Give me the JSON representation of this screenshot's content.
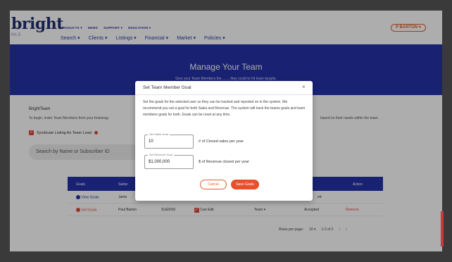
{
  "header": {
    "logo": "bright",
    "logo_sub": "MLS",
    "util_nav": [
      "PRODUCTS ▾",
      "NEWS",
      "SUPPORT ▾",
      "EDUCATION ▾"
    ],
    "main_nav": [
      "Search ▾",
      "Clients ▾",
      "Listings ▾",
      "Financial ▾",
      "Market ▾",
      "Policies ▾"
    ],
    "user": "P BARTON ▾"
  },
  "banner": {
    "title": "Manage Your Team",
    "subtitle": "Give your Team Members the ...                 ... they could to hit team targets."
  },
  "content": {
    "team_label": "BrightTeam",
    "team_desc": "To begin, invite Team Members from your brokerag",
    "team_desc_right": "based on their needs within the team.",
    "syndicate_label": "Syndicate Listing As Team Lead",
    "search_placeholder": "Search by Name or Subscriber ID"
  },
  "table": {
    "headers": [
      "Goals",
      "Subsc",
      "Action"
    ],
    "rows": [
      {
        "goal": "View Goals",
        "name": "Jame",
        "status": "ed",
        "action": ""
      },
      {
        "goal": "Set Goals",
        "name": "Paul Barton",
        "id": "SUERS9",
        "perm": "Can Edit",
        "role": "Team ▾",
        "status": "Accepted",
        "action": "Remove"
      }
    ],
    "pager": {
      "rows_per_page": "Rows per page:",
      "rpp_value": "10 ▾",
      "range": "1-2 of 2",
      "prev": "‹",
      "next": "›"
    }
  },
  "modal": {
    "title": "Set Team Member Goal",
    "close": "×",
    "body": "Set the goals for the selected user so they can be tracked and reported on in the system. We recommend you set a goal for both Sales and Revenue. The system will track the teams goals and team members goals for both. Goals can be reset at any time.",
    "sales_label": "Set Sales Goal",
    "sales_value": "10",
    "sales_desc": "# of Closed sales per year",
    "revenue_label": "Set Revenue Goal",
    "revenue_value": "$1,000,000",
    "revenue_desc": "$ of Revenue closed per year",
    "cancel": "Cancel",
    "save": "Save Goals"
  },
  "colors": {
    "brand_blue": "#2533a8",
    "accent_orange": "#e8502c"
  }
}
